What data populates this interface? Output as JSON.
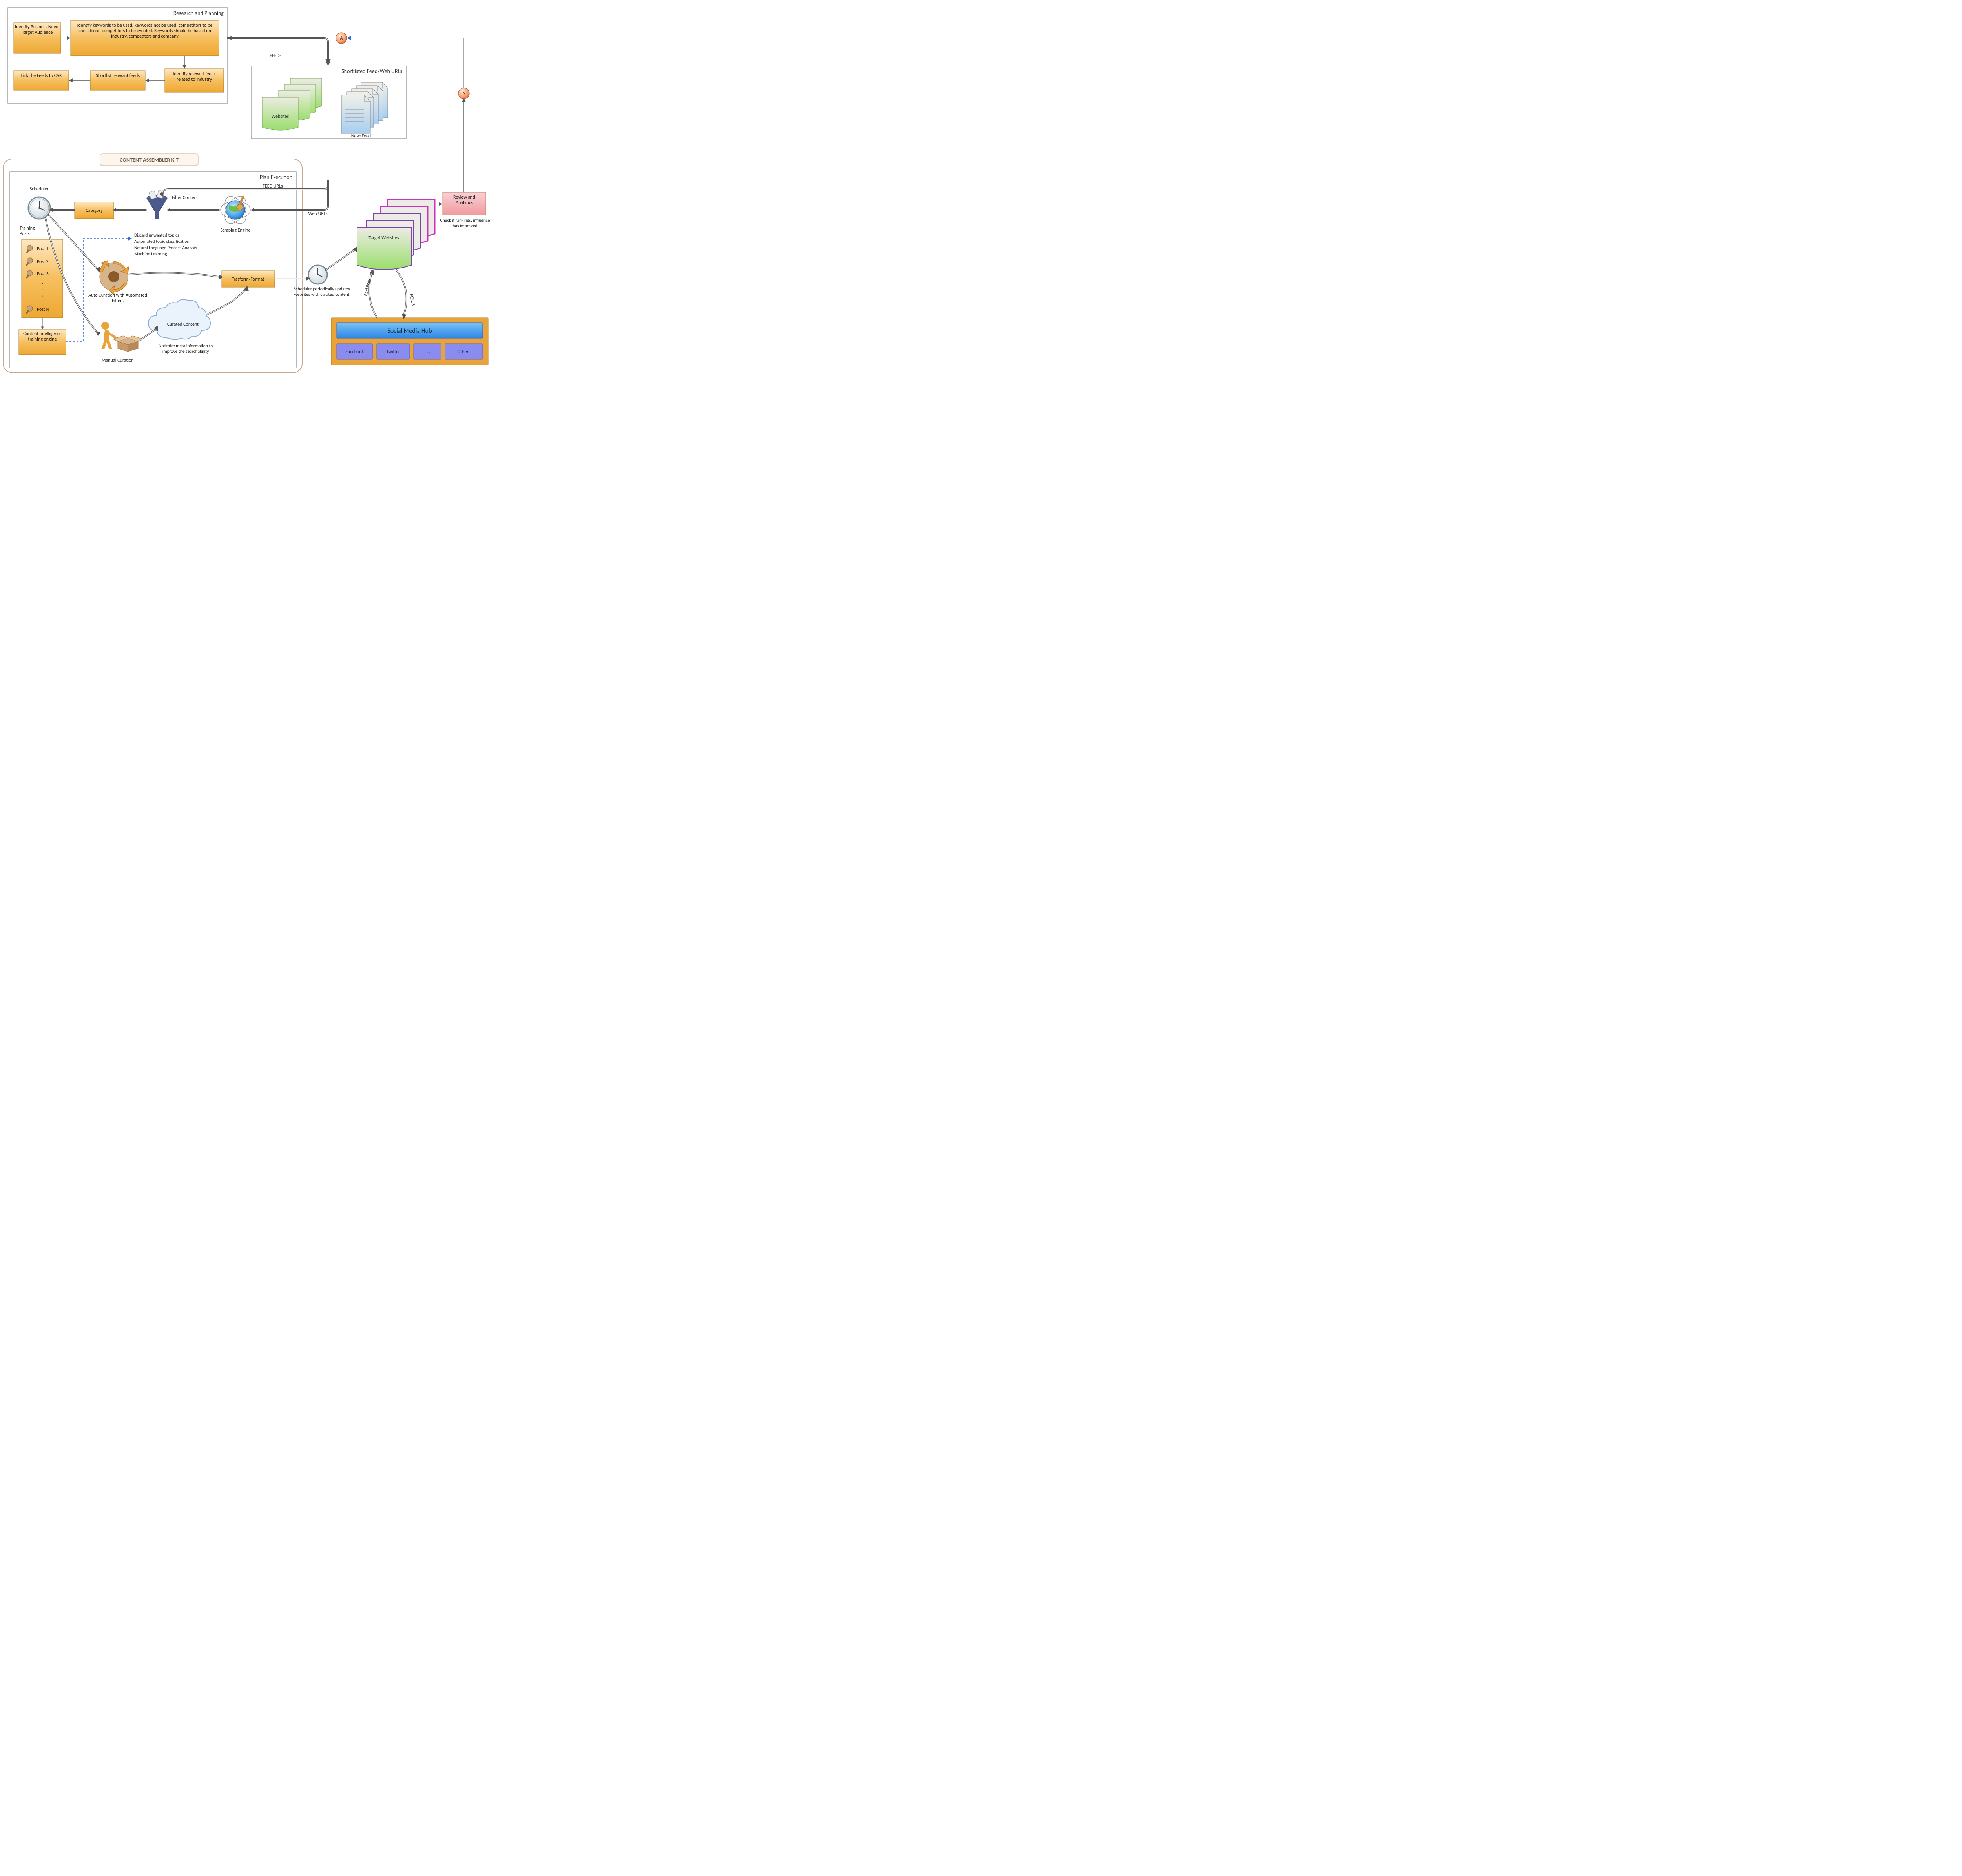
{
  "groups": {
    "research": "Research and Planning",
    "shortlisted": "Shortlisted Feed/Web URLs",
    "planexec": "Plan Execution",
    "cak": "CONTENT ASSEMBLER KIT"
  },
  "boxes": {
    "identifyNeed": "Identify Business Need, Target Audience",
    "identifyKeywords": "Identify keywords to be used, keywords not be used, competitors to be considered, competitors to be avoided. Keywords should be based on industry, competitors and company",
    "relevantFeeds": "Identify relevant feeds related to industry",
    "shortlistFeeds": "Shortlist relevant feeds",
    "linkFeeds": "Link the Feeds to CAK",
    "category": "Category",
    "transform": "Trasform/Format",
    "ciTraining": "Content intelligence training engine",
    "review": "Review and Analytics"
  },
  "icons": {
    "websites": "Websites",
    "newsfeed": "NewsFeed",
    "scheduler": "Scheduler",
    "trainingPosts": "Training Posts",
    "filterContent": "Filter Content",
    "scraping": "Scraping Engine",
    "autoCuration": "Auto Curation with Automated Filters",
    "manualCuration": "Manual Curation",
    "curatedContent": "Curated Content",
    "targetWebsites": "Target Websites"
  },
  "notes": {
    "filterList": [
      "Discard unwanted topics",
      "Automated topic classification",
      "Natural Language Process Analysis",
      "Machine Learning"
    ],
    "curatedNote": "Optimize meta information to improve the searchability",
    "schedulerNote": "Scheduler periodically updates websites with curated content",
    "reviewNote": "Check if rankings, influence has improved"
  },
  "edgeLabels": {
    "feeds": "FEEDs",
    "feedUrls": "FEED URLs",
    "webUrls": "Web URLs",
    "backlinks": "Backlinks",
    "feedsOut": "FEEDS"
  },
  "connectors": {
    "A": "A"
  },
  "posts": [
    "Post 1",
    "Post 2",
    "Post 3",
    "Post N"
  ],
  "social": {
    "title": "Social Media Hub",
    "items": [
      "Facebook",
      "Twitter",
      ". . .",
      "Others"
    ]
  }
}
